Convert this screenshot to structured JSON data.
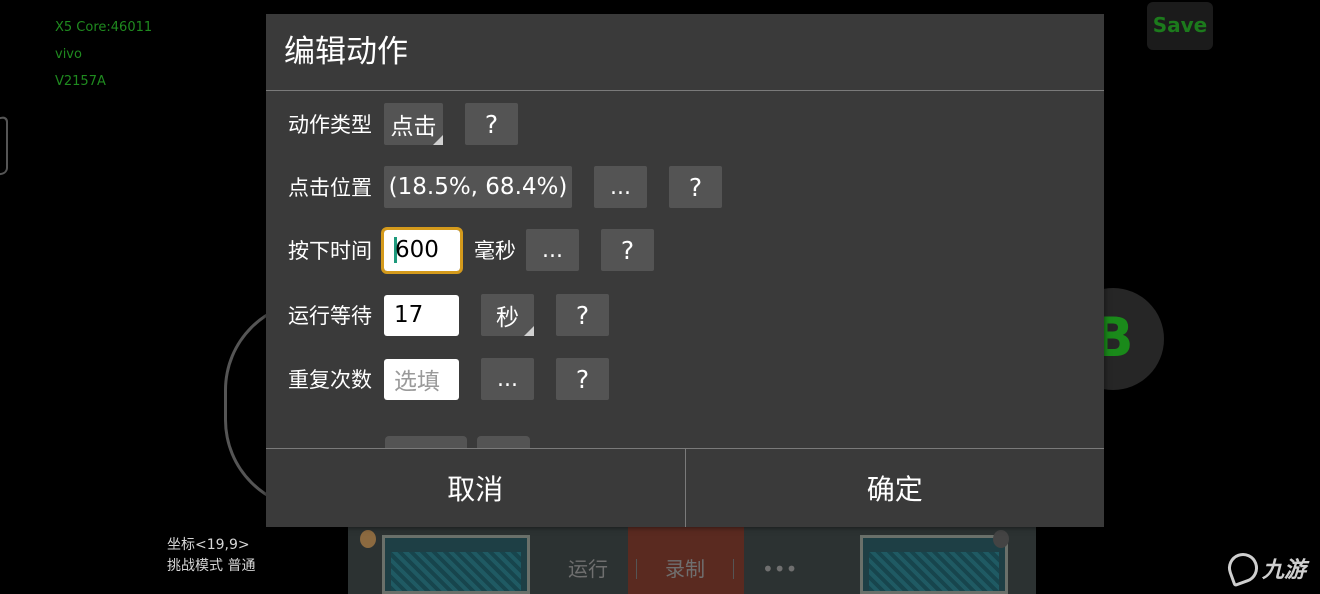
{
  "device_info": {
    "line1": "X5  Core:46011",
    "line2": "vivo",
    "line3": "V2157A"
  },
  "background": {
    "save_button_label": "Save",
    "b_button_label": "B",
    "coords_label": "坐标<19,9>",
    "mode_label": "挑战模式 普通",
    "bottom_bar": {
      "run_label": "运行",
      "record_label": "录制",
      "more_label": "•••"
    },
    "watermark_text": "九游"
  },
  "dialog": {
    "title": "编辑动作",
    "rows": {
      "action_type": {
        "label": "动作类型",
        "value": "点击",
        "help": "?"
      },
      "click_position": {
        "label": "点击位置",
        "value": "(18.5%,  68.4%)",
        "more": "...",
        "help": "?"
      },
      "press_time": {
        "label": "按下时间",
        "value": "600",
        "unit": "毫秒",
        "more": "...",
        "help": "?"
      },
      "run_wait": {
        "label": "运行等待",
        "value": "17",
        "unit": "秒",
        "help": "?"
      },
      "repeat_count": {
        "label": "重复次数",
        "value": "",
        "placeholder": "选填",
        "more": "...",
        "help": "?"
      }
    },
    "cancel_label": "取消",
    "confirm_label": "确定"
  },
  "colors": {
    "dialog_bg": "#3a3a3a",
    "button_bg": "#545454",
    "focus_outline": "#d49a1c",
    "caret": "#1e9a7c",
    "debug_text": "#1f8a1f"
  }
}
